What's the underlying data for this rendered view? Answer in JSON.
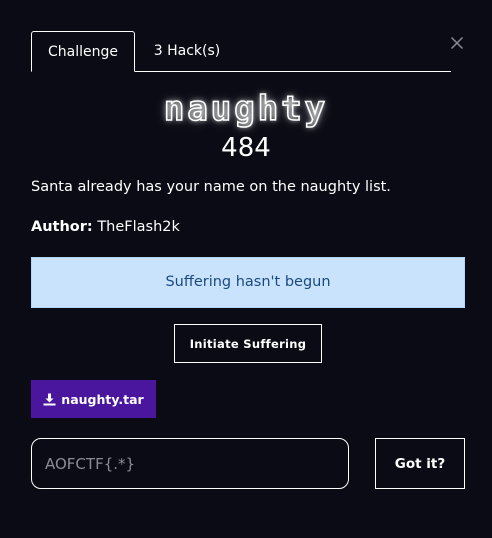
{
  "tabs": [
    {
      "label": "Challenge"
    },
    {
      "label": "3 Hack(s)"
    }
  ],
  "challenge": {
    "name": "naughty",
    "points": "484",
    "description": "Santa already has your name on the naughty list.",
    "author_label": "Author:",
    "author_name": "TheFlash2k"
  },
  "status": {
    "message": "Suffering hasn't begun"
  },
  "actions": {
    "initiate_label": "Initiate Suffering",
    "file_label": "naughty.tar",
    "submit_label": "Got it?"
  },
  "flag_input": {
    "placeholder": "AOFCTF{.*}",
    "value": ""
  },
  "colors": {
    "background": "#0a0b14",
    "status_bg": "#c9e3fc",
    "status_text": "#1b4a80",
    "file_button_bg": "#4a169e"
  },
  "icons": {
    "close": "close-icon",
    "download": "download-icon"
  }
}
